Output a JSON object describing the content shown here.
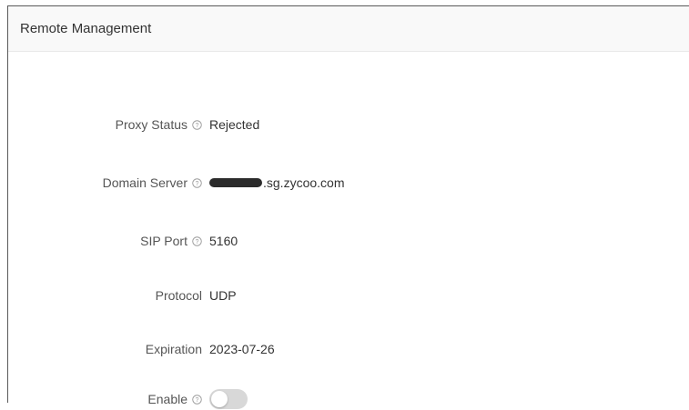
{
  "panel": {
    "title": "Remote Management"
  },
  "fields": {
    "proxy_status": {
      "label": "Proxy Status",
      "value": "Rejected",
      "help_icon": "question-circle-icon"
    },
    "domain_server": {
      "label": "Domain Server",
      "value_suffix": ".sg.zycoo.com",
      "help_icon": "question-circle-icon"
    },
    "sip_port": {
      "label": "SIP Port",
      "value": "5160",
      "help_icon": "question-circle-icon"
    },
    "protocol": {
      "label": "Protocol",
      "value": "UDP"
    },
    "expiration": {
      "label": "Expiration",
      "value": "2023-07-26"
    },
    "enable": {
      "label": "Enable",
      "checked": false,
      "help_icon": "question-circle-icon"
    }
  },
  "colors": {
    "toggle_off": "#d8d8d8",
    "header_bg": "#f9f9f9"
  }
}
